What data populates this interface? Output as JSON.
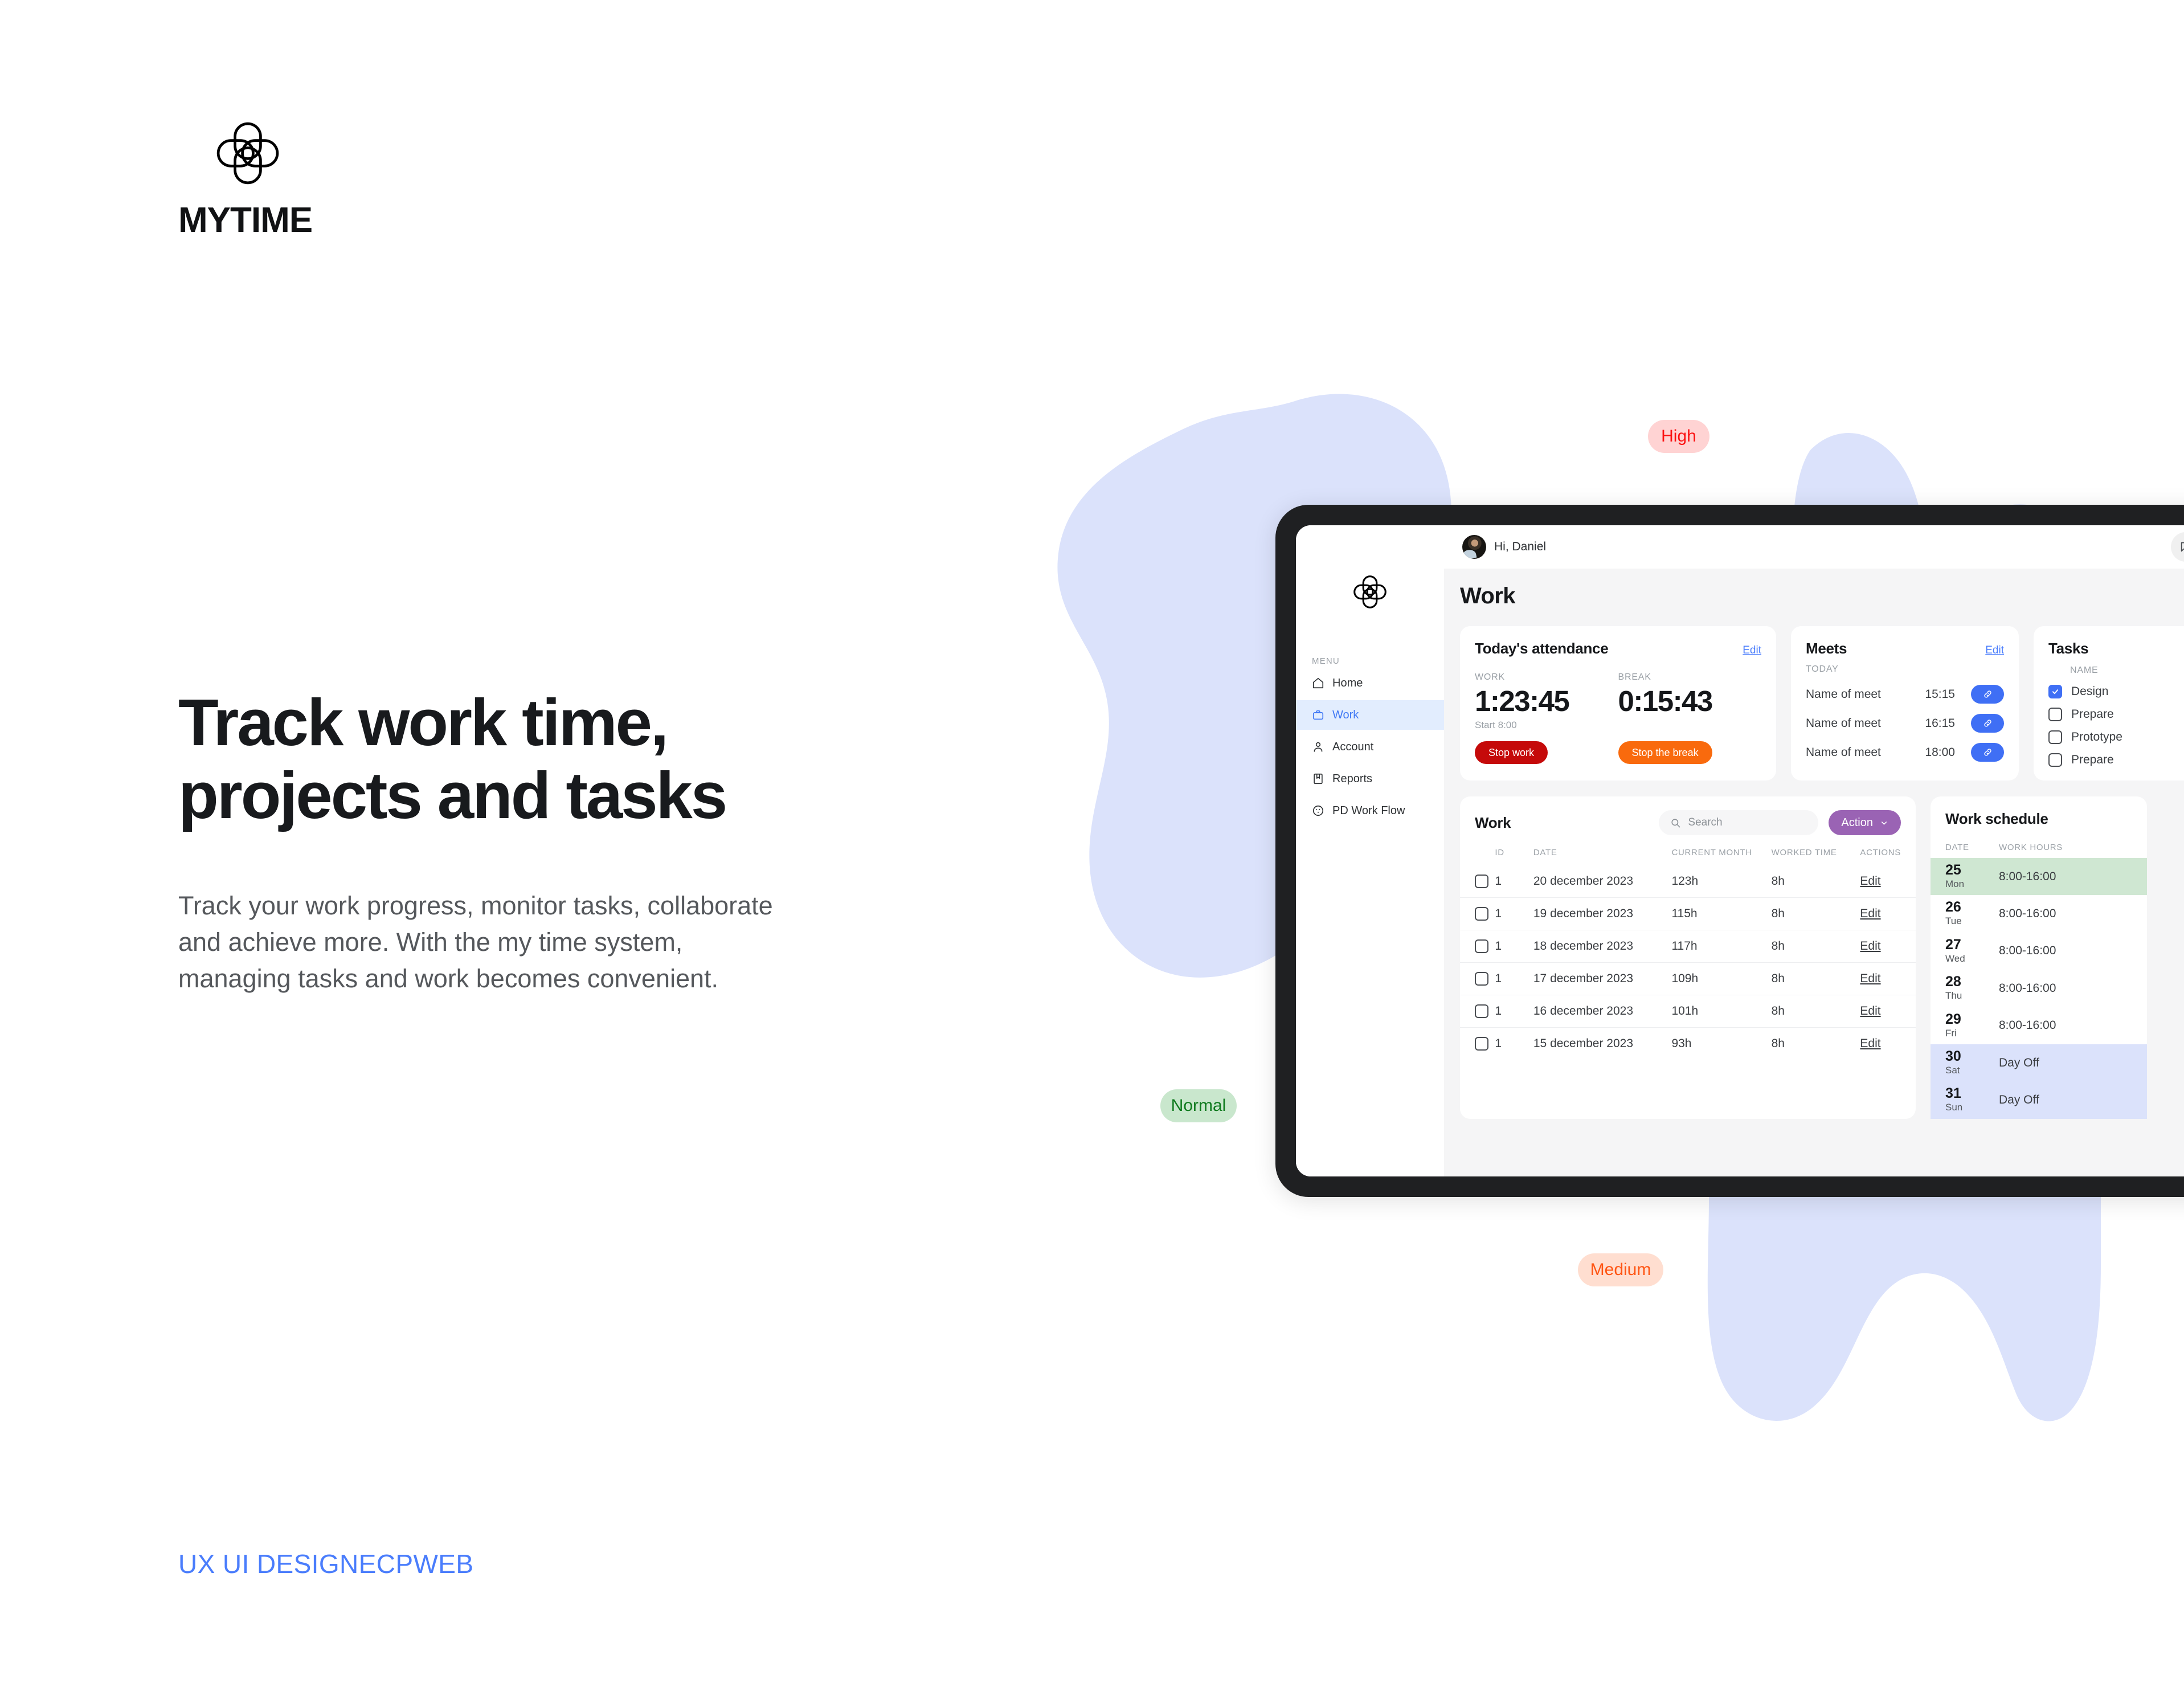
{
  "brand": {
    "name": "MYTIME",
    "logo_icon": "clover-logo-icon"
  },
  "hero": {
    "headline_line1": "Track work time,",
    "headline_line2": "projects and tasks",
    "subcopy_line1": "Track your work progress, monitor tasks, collaborate",
    "subcopy_line2": "and achieve more. With the my time system,",
    "subcopy_line3": "managing tasks and work becomes convenient."
  },
  "footer_links": [
    {
      "label": "UX UI DESIGN"
    },
    {
      "label": "ECP"
    },
    {
      "label": "WEB"
    }
  ],
  "floating_badges": [
    {
      "label": "High",
      "bg": "#ffd3d3",
      "color": "#fb1212"
    },
    {
      "label": "Normal",
      "bg": "#c9e7cd",
      "color": "#0e7a1d"
    },
    {
      "label": "Medium",
      "bg": "#ffded0",
      "color": "#ff5412"
    }
  ],
  "colors": {
    "accent_blue": "#3f6ff5",
    "link_blue": "#4a7dfc",
    "blob_blue": "#dbe2fb",
    "stop_work_red": "#c50a0a",
    "stop_break_orange": "#f96a0d",
    "action_purple": "#9a63b4",
    "today_green": "#cfe7d2",
    "dayoff_blue": "#dbe2fb",
    "device_frame": "#1f2022"
  },
  "dashboard": {
    "sidebar": {
      "logo_icon": "clover-logo-icon",
      "menu_label": "MENU",
      "items": [
        {
          "label": "Home",
          "icon": "home-icon",
          "active": false
        },
        {
          "label": "Work",
          "icon": "briefcase-icon",
          "active": true
        },
        {
          "label": "Account",
          "icon": "person-icon",
          "active": false
        },
        {
          "label": "Reports",
          "icon": "bookmark-icon",
          "active": false
        },
        {
          "label": "PD Work Flow",
          "icon": "palette-icon",
          "active": false
        }
      ]
    },
    "topbar": {
      "greeting": "Hi, Daniel",
      "avatar_icon": "user-avatar",
      "message_icon": "message-icon",
      "bell_icon": "bell-icon"
    },
    "page_title": "Work",
    "attendance": {
      "title": "Today's attendance",
      "edit_label": "Edit",
      "work_label": "WORK",
      "work_time": "1:23:45",
      "start_label": "Start 8:00",
      "stop_work_label": "Stop work",
      "break_label": "BREAK",
      "break_time": "0:15:43",
      "stop_break_label": "Stop the break"
    },
    "meets": {
      "title": "Meets",
      "edit_label": "Edit",
      "subtitle": "TODAY",
      "rows": [
        {
          "name": "Name of meet",
          "time": "15:15",
          "icon": "link-icon"
        },
        {
          "name": "Name of meet",
          "time": "16:15",
          "icon": "link-icon"
        },
        {
          "name": "Name of meet",
          "time": "18:00",
          "icon": "link-icon"
        }
      ]
    },
    "tasks": {
      "title": "Tasks",
      "column_header": "NAME",
      "rows": [
        {
          "name": "Design",
          "checked": true
        },
        {
          "name": "Prepare",
          "checked": false
        },
        {
          "name": "Prototype",
          "checked": false
        },
        {
          "name": "Prepare",
          "checked": false
        }
      ]
    },
    "work_table": {
      "title": "Work",
      "search_placeholder": "Search",
      "search_icon": "search-icon",
      "action_label": "Action",
      "action_icon": "chevron-down-icon",
      "columns": [
        "ID",
        "DATE",
        "CURRENT MONTH",
        "WORKED TIME",
        "ACTIONS"
      ],
      "rows": [
        {
          "id": "1",
          "date": "20 december 2023",
          "current_month": "123h",
          "worked_time": "8h",
          "action": "Edit"
        },
        {
          "id": "1",
          "date": "19 december 2023",
          "current_month": "115h",
          "worked_time": "8h",
          "action": "Edit"
        },
        {
          "id": "1",
          "date": "18 december 2023",
          "current_month": "117h",
          "worked_time": "8h",
          "action": "Edit"
        },
        {
          "id": "1",
          "date": "17 december 2023",
          "current_month": "109h",
          "worked_time": "8h",
          "action": "Edit"
        },
        {
          "id": "1",
          "date": "16 december 2023",
          "current_month": "101h",
          "worked_time": "8h",
          "action": "Edit"
        },
        {
          "id": "1",
          "date": "15 december 2023",
          "current_month": "93h",
          "worked_time": "8h",
          "action": "Edit"
        }
      ]
    },
    "work_schedule": {
      "title": "Work schedule",
      "columns": [
        "DATE",
        "WORK HOURS"
      ],
      "rows": [
        {
          "day": "25",
          "dow": "Mon",
          "hours": "8:00-16:00",
          "state": "today"
        },
        {
          "day": "26",
          "dow": "Tue",
          "hours": "8:00-16:00",
          "state": "normal"
        },
        {
          "day": "27",
          "dow": "Wed",
          "hours": "8:00-16:00",
          "state": "normal"
        },
        {
          "day": "28",
          "dow": "Thu",
          "hours": "8:00-16:00",
          "state": "normal"
        },
        {
          "day": "29",
          "dow": "Fri",
          "hours": "8:00-16:00",
          "state": "normal"
        },
        {
          "day": "30",
          "dow": "Sat",
          "hours": "Day Off",
          "state": "dayoff"
        },
        {
          "day": "31",
          "dow": "Sun",
          "hours": "Day Off",
          "state": "dayoff"
        }
      ]
    }
  }
}
